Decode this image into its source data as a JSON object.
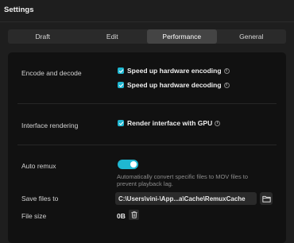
{
  "window": {
    "title": "Settings"
  },
  "tabs": [
    {
      "label": "Draft",
      "active": false
    },
    {
      "label": "Edit",
      "active": false
    },
    {
      "label": "Performance",
      "active": true
    },
    {
      "label": "General",
      "active": false
    }
  ],
  "encode": {
    "label": "Encode and decode",
    "options": [
      {
        "label": "Speed up hardware encoding",
        "checked": true
      },
      {
        "label": "Speed up hardware decoding",
        "checked": true
      }
    ]
  },
  "rendering": {
    "label": "Interface rendering",
    "option": {
      "label": "Render interface with GPU",
      "checked": true
    }
  },
  "remux": {
    "label": "Auto remux",
    "enabled": true,
    "description": "Automatically convert specific files to MOV files to prevent playback lag."
  },
  "save_files": {
    "label": "Save files to",
    "path": "C:\\Users\\vini-\\App...a\\Cache\\RemuxCache"
  },
  "file_size": {
    "label": "File size",
    "value": "0B"
  },
  "colors": {
    "accent": "#1fb7d1",
    "background": "#1e1e1e",
    "panel": "#111111"
  },
  "icons": [
    "checkmark-icon",
    "info-icon",
    "folder-icon",
    "trash-icon"
  ]
}
